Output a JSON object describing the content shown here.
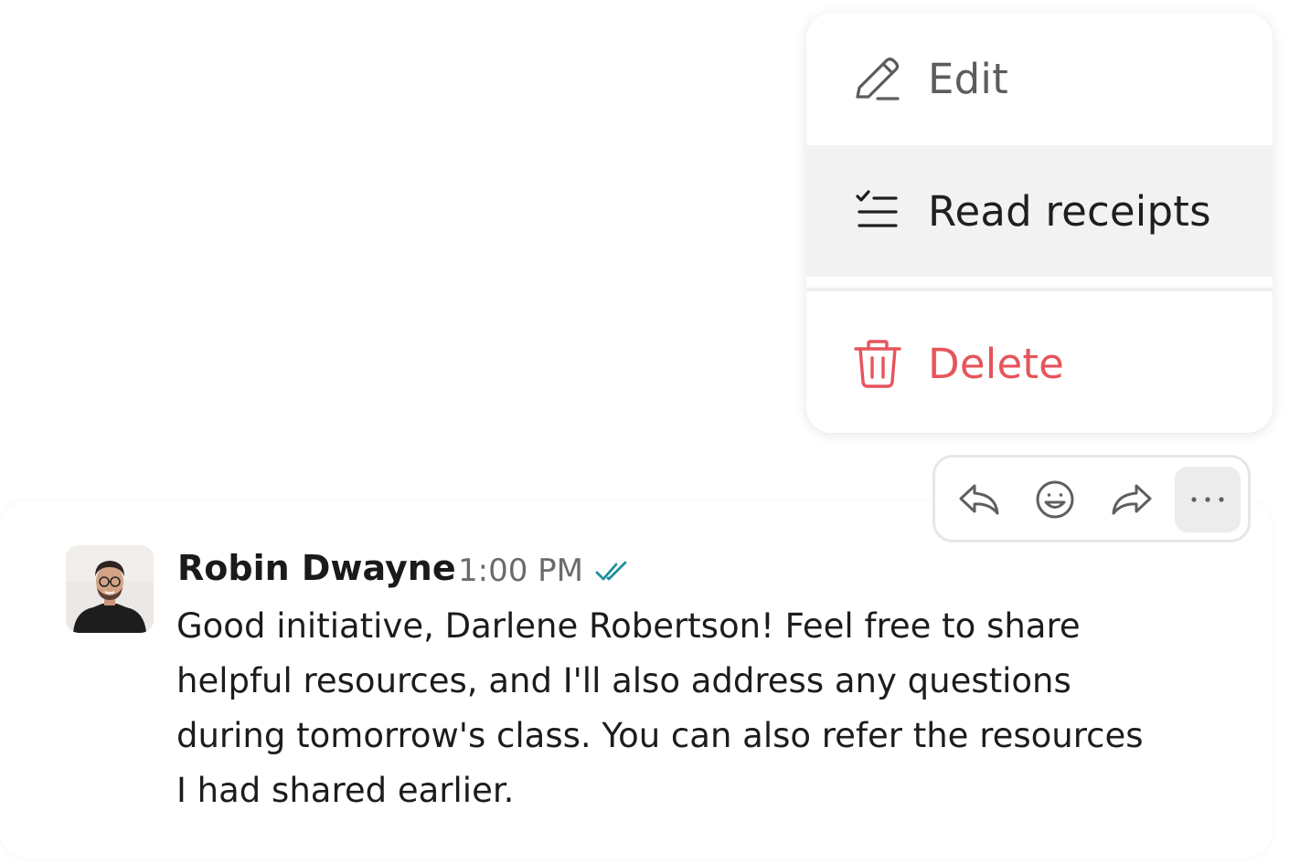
{
  "menu": {
    "items": [
      {
        "label": "Edit",
        "icon": "pencil-icon"
      },
      {
        "label": "Read receipts",
        "icon": "checklist-icon"
      },
      {
        "label": "Delete",
        "icon": "trash-icon"
      }
    ]
  },
  "actions": {
    "icons": [
      "reply-icon",
      "emoji-icon",
      "forward-icon",
      "more-icon"
    ]
  },
  "message": {
    "author": "Robin Dwayne",
    "time": "1:00 PM",
    "status_icon": "double-check-icon",
    "lines": [
      "Good initiative, Darlene Robertson! Feel free to share",
      "helpful resources, and I'll also address any questions",
      "during tomorrow's class. You can also refer the resources",
      "I had shared earlier."
    ]
  },
  "colors": {
    "delete": "#e6555b",
    "read_receipt_check": "#1e8fa0",
    "hover_bg": "#f2f2f2"
  }
}
